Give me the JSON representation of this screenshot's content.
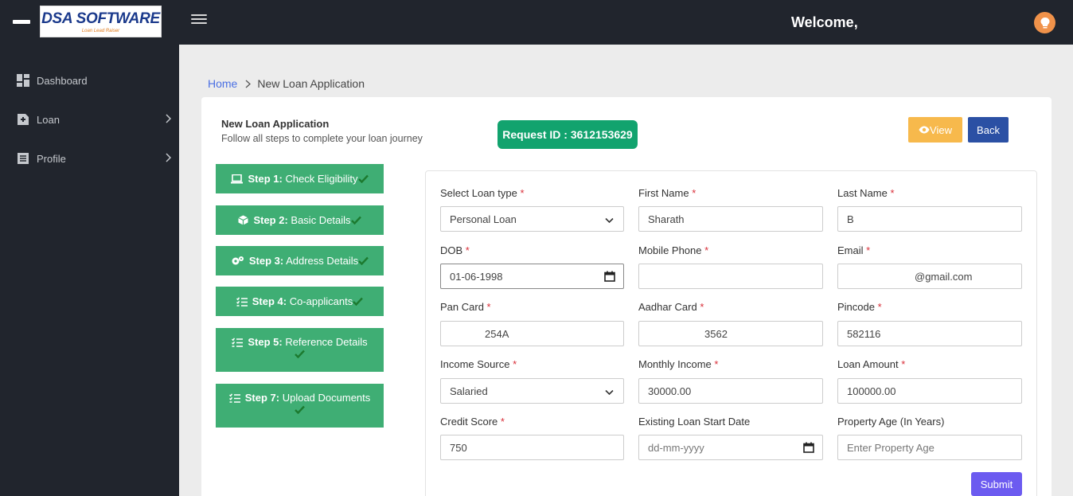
{
  "header": {
    "brand_name": "DSA SOFTWARE",
    "brand_tagline": "Loan Lead Raiser",
    "welcome": "Welcome,"
  },
  "sidebar": {
    "items": [
      {
        "label": "Dashboard",
        "icon": "dashboard-icon"
      },
      {
        "label": "Loan",
        "icon": "add-document-icon"
      },
      {
        "label": "Profile",
        "icon": "list-icon"
      }
    ]
  },
  "breadcrumb": {
    "home": "Home",
    "current": "New Loan Application"
  },
  "card": {
    "title": "New Loan Application",
    "subtitle": "Follow all steps to complete your loan journey",
    "request_id": "Request ID : 3612153629",
    "view_label": "View",
    "back_label": "Back"
  },
  "steps": [
    {
      "prefix": "Step 1:",
      "name": "Check Eligibility",
      "icon": "laptop-icon",
      "done": true
    },
    {
      "prefix": "Step 2:",
      "name": "Basic Details",
      "icon": "cube-icon",
      "done": true
    },
    {
      "prefix": "Step 3:",
      "name": "Address Details",
      "icon": "gears-icon",
      "done": true
    },
    {
      "prefix": "Step 4:",
      "name": "Co-applicants",
      "icon": "list-check-icon",
      "done": true
    },
    {
      "prefix": "Step 5:",
      "name": "Reference Details",
      "icon": "list-check-icon",
      "done": true
    },
    {
      "prefix": "Step 7:",
      "name": "Upload Documents",
      "icon": "list-check-icon",
      "done": true
    }
  ],
  "form": {
    "loan_type": {
      "label": "Select Loan type",
      "value": "Personal Loan"
    },
    "first_name": {
      "label": "First Name",
      "value": "Sharath"
    },
    "last_name": {
      "label": "Last Name",
      "value": "B"
    },
    "dob": {
      "label": "DOB",
      "value": "01-06-1998"
    },
    "mobile": {
      "label": "Mobile Phone",
      "value": ""
    },
    "email": {
      "label": "Email",
      "value": "@gmail.com"
    },
    "pan": {
      "label": "Pan Card",
      "value": "254A"
    },
    "aadhar": {
      "label": "Aadhar Card",
      "value": "3562"
    },
    "pincode": {
      "label": "Pincode",
      "value": "582116"
    },
    "income_source": {
      "label": "Income Source",
      "value": "Salaried"
    },
    "monthly_income": {
      "label": "Monthly Income",
      "value": "30000.00"
    },
    "loan_amount": {
      "label": "Loan Amount",
      "value": "100000.00"
    },
    "credit_score": {
      "label": "Credit Score",
      "value": "750"
    },
    "existing_loan_date": {
      "label": "Existing Loan Start Date",
      "placeholder": "dd-mm-yyyy"
    },
    "property_age": {
      "label": "Property Age (In Years)",
      "placeholder": "Enter Property Age"
    },
    "required_mark": "*",
    "submit_label": "Submit"
  },
  "colors": {
    "step_bg": "#3fae74",
    "badge_bg": "#12a36e",
    "view_btn": "#f7b94c",
    "back_btn": "#2b50a4",
    "submit_btn": "#6c5bf0",
    "sidebar_bg": "#21252d"
  }
}
